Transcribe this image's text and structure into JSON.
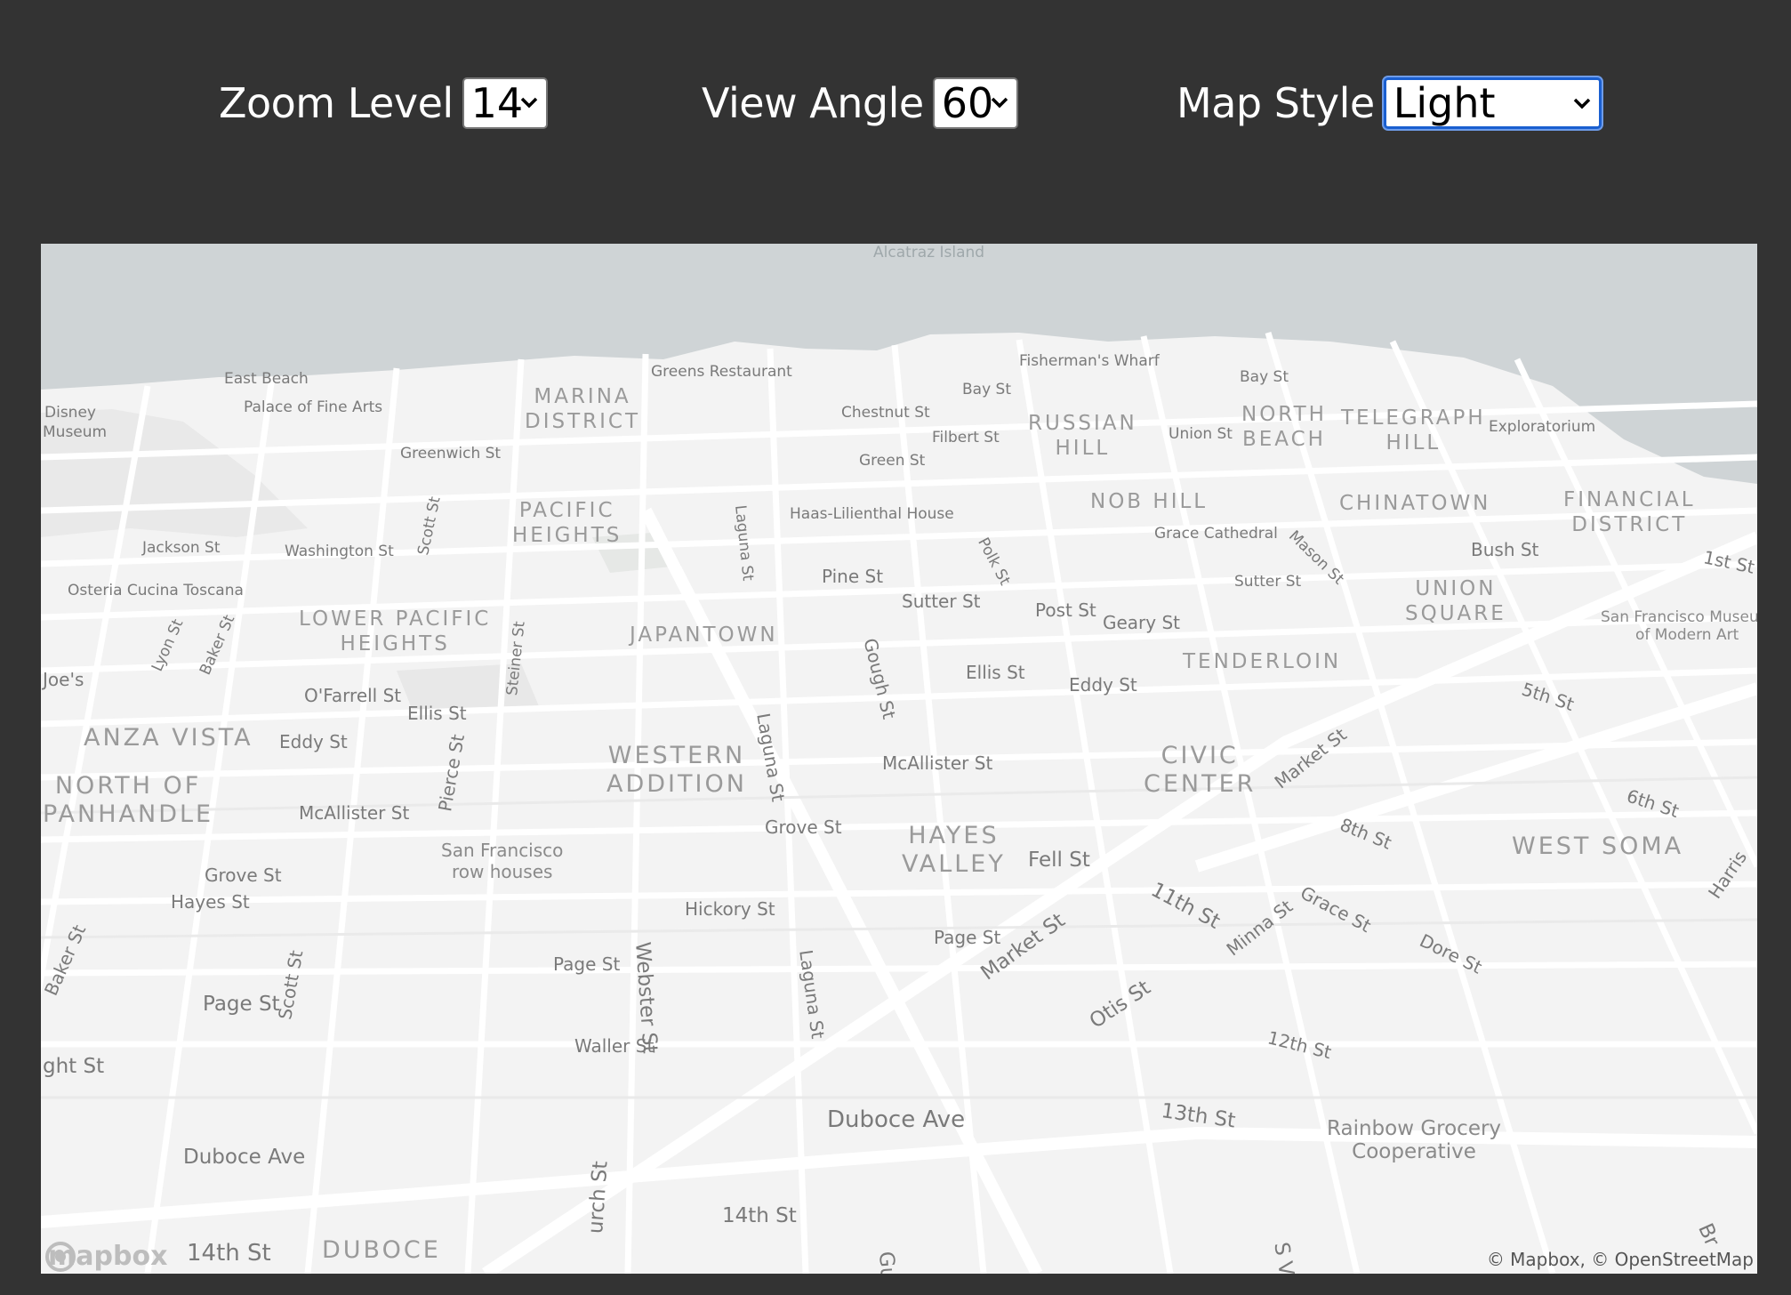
{
  "controls": {
    "zoom": {
      "label": "Zoom Level",
      "value": "14"
    },
    "angle": {
      "label": "View Angle",
      "value": "60"
    },
    "style": {
      "label": "Map Style",
      "value": "Light"
    }
  },
  "map": {
    "attribution": "© Mapbox, © OpenStreetMap",
    "logo_text": "mapbox",
    "labels": {
      "alcatraz": "Alcatraz Island",
      "east_beach": "East Beach",
      "palace": "Palace of Fine Arts",
      "disney1": "Disney",
      "disney2": "Museum",
      "greens": "Greens Restaurant",
      "fishermans": "Fisherman's Wharf",
      "bay_st_1": "Bay St",
      "bay_st_2": "Bay St",
      "marina": "MARINA\nDISTRICT",
      "chestnut": "Chestnut St",
      "filbert": "Filbert St",
      "russian_hill": "RUSSIAN\nHILL",
      "union_st": "Union St",
      "north_beach": "NORTH\nBEACH",
      "telegraph_hill": "TELEGRAPH\nHILL",
      "exploratorium": "Exploratorium",
      "greenwich": "Greenwich St",
      "green_st": "Green St",
      "pacific_heights": "PACIFIC\nHEIGHTS",
      "laguna_1": "Laguna St",
      "haas": "Haas-Lilienthal House",
      "nob_hill": "NOB HILL",
      "chinatown": "CHINATOWN",
      "financial": "FINANCIAL\nDISTRICT",
      "scott_1": "Scott St",
      "polk": "Polk St",
      "grace_cathedral": "Grace Cathedral",
      "mason": "Mason St",
      "jackson": "Jackson St",
      "washington": "Washington St",
      "bush": "Bush St",
      "first_st": "1st St",
      "osteria": "Osteria Cucina Toscana",
      "pine": "Pine St",
      "sutter_1": "Sutter St",
      "sutter_2": "Sutter St",
      "union_square": "UNION\nSQUARE",
      "lower_pacific": "LOWER PACIFIC\nHEIGHTS",
      "japantown": "JAPANTOWN",
      "post": "Post St",
      "geary": "Geary St",
      "sfmoma": "San Francisco Museum\nof Modern Art",
      "lyon": "Lyon St",
      "baker_1": "Baker St",
      "steiner": "Steiner St",
      "gough": "Gough St",
      "tenderloin": "TENDERLOIN",
      "joes": "Joe's",
      "ofarrell": "O'Farrell St",
      "ellis_1": "Ellis St",
      "ellis_2": "Ellis St",
      "eddy_2": "Eddy St",
      "fifth": "5th St",
      "anza_vista": "ANZA VISTA",
      "eddy_1": "Eddy St",
      "laguna_2": "Laguna St",
      "western_addition": "WESTERN\nADDITION",
      "civic_center": "CIVIC\nCENTER",
      "market_1": "Market St",
      "north_panhandle": "NORTH OF\nPANHANDLE",
      "pierce": "Pierce St",
      "mcallister_2": "McAllister St",
      "sixth": "6th St",
      "mcallister_1": "McAllister St",
      "eighth": "8th St",
      "hayes_valley": "HAYES\nVALLEY",
      "grove_2": "Grove St",
      "west_soma": "WEST SOMA",
      "painted_ladies": "San Francisco\nrow houses",
      "fell": "Fell St",
      "grove_1": "Grove St",
      "hayes": "Hayes St",
      "harrison": "Harris",
      "eleventh": "11th St",
      "grace_st": "Grace St",
      "hickory": "Hickory St",
      "baker_2": "Baker St",
      "webster": "Webster St",
      "minna": "Minna St",
      "dore": "Dore St",
      "page_3": "Page St",
      "laguna_3": "Laguna St",
      "market_2": "Market St",
      "page_2": "Page St",
      "scott_2": "Scott St",
      "page_1": "Page St",
      "otis": "Otis St",
      "twelfth": "12th St",
      "waller": "Waller St",
      "haight": "ght St",
      "thirteenth": "13th St",
      "duboce_ave_2": "Duboce Ave",
      "rainbow": "Rainbow Grocery\nCooperative",
      "duboce_ave_1": "Duboce Ave",
      "church": "urch St",
      "fourteenth_2": "14th St",
      "guerrero": "Gue",
      "s_van_ness": "S Va",
      "bryant": "Br",
      "fourteenth_1": "14th St",
      "duboce": "DUBOCE"
    }
  }
}
